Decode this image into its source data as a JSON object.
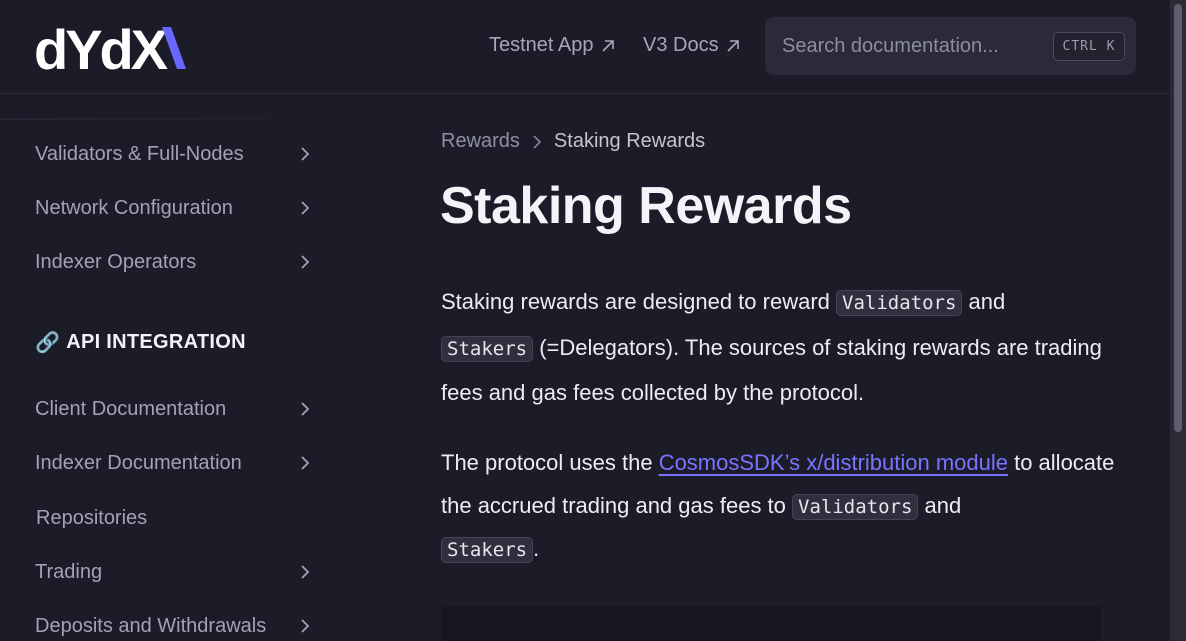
{
  "header": {
    "logo_text": "dYdX",
    "nav": [
      {
        "label": "Testnet App",
        "icon": "external-arrow-icon"
      },
      {
        "label": "V3 Docs",
        "icon": "external-arrow-icon"
      }
    ],
    "search": {
      "placeholder": "Search documentation...",
      "shortcut": "CTRL K"
    }
  },
  "sidebar": {
    "items_top": [
      {
        "label": "Validators & Full-Nodes",
        "has_chevron": true
      },
      {
        "label": "Network Configuration",
        "has_chevron": true
      },
      {
        "label": "Indexer Operators",
        "has_chevron": true
      }
    ],
    "section": {
      "icon": "link-icon",
      "emoji": "🔗",
      "label": "API INTEGRATION"
    },
    "items_bottom": [
      {
        "label": "Client Documentation",
        "has_chevron": true
      },
      {
        "label": "Indexer Documentation",
        "has_chevron": true
      },
      {
        "label": "Repositories",
        "has_chevron": false
      },
      {
        "label": "Trading",
        "has_chevron": true
      },
      {
        "label": "Deposits and Withdrawals",
        "has_chevron": true
      }
    ]
  },
  "breadcrumb": {
    "parent": "Rewards",
    "current": "Staking Rewards"
  },
  "page": {
    "title": "Staking Rewards",
    "p1": {
      "t1": "Staking rewards are designed to reward ",
      "c1": "Validators",
      "t2": " and ",
      "c2": "Stakers",
      "t3": " (=Delegators). The sources of staking rewards are trading fees and gas fees collected by the protocol."
    },
    "p2": {
      "t1": "The protocol uses the ",
      "link": "CosmosSDK’s x/distribution module",
      "t2": " to allocate the accrued trading and gas fees to ",
      "c1": "Validators",
      "t3": " and ",
      "c2": "Stakers",
      "t4": "."
    }
  },
  "colors": {
    "background": "#1c1c28",
    "accent": "#7774ff",
    "logo_accent": "#6966ff"
  }
}
